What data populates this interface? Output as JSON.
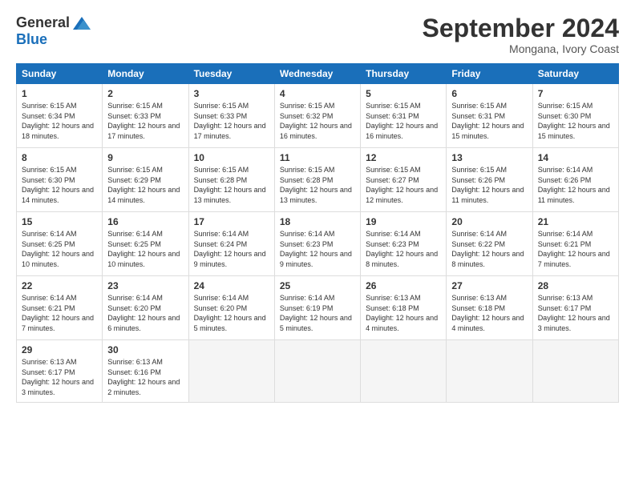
{
  "logo": {
    "general": "General",
    "blue": "Blue"
  },
  "title": "September 2024",
  "location": "Mongana, Ivory Coast",
  "headers": [
    "Sunday",
    "Monday",
    "Tuesday",
    "Wednesday",
    "Thursday",
    "Friday",
    "Saturday"
  ],
  "weeks": [
    [
      {
        "day": "1",
        "sunrise": "6:15 AM",
        "sunset": "6:34 PM",
        "daylight": "12 hours and 18 minutes."
      },
      {
        "day": "2",
        "sunrise": "6:15 AM",
        "sunset": "6:33 PM",
        "daylight": "12 hours and 17 minutes."
      },
      {
        "day": "3",
        "sunrise": "6:15 AM",
        "sunset": "6:33 PM",
        "daylight": "12 hours and 17 minutes."
      },
      {
        "day": "4",
        "sunrise": "6:15 AM",
        "sunset": "6:32 PM",
        "daylight": "12 hours and 16 minutes."
      },
      {
        "day": "5",
        "sunrise": "6:15 AM",
        "sunset": "6:31 PM",
        "daylight": "12 hours and 16 minutes."
      },
      {
        "day": "6",
        "sunrise": "6:15 AM",
        "sunset": "6:31 PM",
        "daylight": "12 hours and 15 minutes."
      },
      {
        "day": "7",
        "sunrise": "6:15 AM",
        "sunset": "6:30 PM",
        "daylight": "12 hours and 15 minutes."
      }
    ],
    [
      {
        "day": "8",
        "sunrise": "6:15 AM",
        "sunset": "6:30 PM",
        "daylight": "12 hours and 14 minutes."
      },
      {
        "day": "9",
        "sunrise": "6:15 AM",
        "sunset": "6:29 PM",
        "daylight": "12 hours and 14 minutes."
      },
      {
        "day": "10",
        "sunrise": "6:15 AM",
        "sunset": "6:28 PM",
        "daylight": "12 hours and 13 minutes."
      },
      {
        "day": "11",
        "sunrise": "6:15 AM",
        "sunset": "6:28 PM",
        "daylight": "12 hours and 13 minutes."
      },
      {
        "day": "12",
        "sunrise": "6:15 AM",
        "sunset": "6:27 PM",
        "daylight": "12 hours and 12 minutes."
      },
      {
        "day": "13",
        "sunrise": "6:15 AM",
        "sunset": "6:26 PM",
        "daylight": "12 hours and 11 minutes."
      },
      {
        "day": "14",
        "sunrise": "6:14 AM",
        "sunset": "6:26 PM",
        "daylight": "12 hours and 11 minutes."
      }
    ],
    [
      {
        "day": "15",
        "sunrise": "6:14 AM",
        "sunset": "6:25 PM",
        "daylight": "12 hours and 10 minutes."
      },
      {
        "day": "16",
        "sunrise": "6:14 AM",
        "sunset": "6:25 PM",
        "daylight": "12 hours and 10 minutes."
      },
      {
        "day": "17",
        "sunrise": "6:14 AM",
        "sunset": "6:24 PM",
        "daylight": "12 hours and 9 minutes."
      },
      {
        "day": "18",
        "sunrise": "6:14 AM",
        "sunset": "6:23 PM",
        "daylight": "12 hours and 9 minutes."
      },
      {
        "day": "19",
        "sunrise": "6:14 AM",
        "sunset": "6:23 PM",
        "daylight": "12 hours and 8 minutes."
      },
      {
        "day": "20",
        "sunrise": "6:14 AM",
        "sunset": "6:22 PM",
        "daylight": "12 hours and 8 minutes."
      },
      {
        "day": "21",
        "sunrise": "6:14 AM",
        "sunset": "6:21 PM",
        "daylight": "12 hours and 7 minutes."
      }
    ],
    [
      {
        "day": "22",
        "sunrise": "6:14 AM",
        "sunset": "6:21 PM",
        "daylight": "12 hours and 7 minutes."
      },
      {
        "day": "23",
        "sunrise": "6:14 AM",
        "sunset": "6:20 PM",
        "daylight": "12 hours and 6 minutes."
      },
      {
        "day": "24",
        "sunrise": "6:14 AM",
        "sunset": "6:20 PM",
        "daylight": "12 hours and 5 minutes."
      },
      {
        "day": "25",
        "sunrise": "6:14 AM",
        "sunset": "6:19 PM",
        "daylight": "12 hours and 5 minutes."
      },
      {
        "day": "26",
        "sunrise": "6:13 AM",
        "sunset": "6:18 PM",
        "daylight": "12 hours and 4 minutes."
      },
      {
        "day": "27",
        "sunrise": "6:13 AM",
        "sunset": "6:18 PM",
        "daylight": "12 hours and 4 minutes."
      },
      {
        "day": "28",
        "sunrise": "6:13 AM",
        "sunset": "6:17 PM",
        "daylight": "12 hours and 3 minutes."
      }
    ],
    [
      {
        "day": "29",
        "sunrise": "6:13 AM",
        "sunset": "6:17 PM",
        "daylight": "12 hours and 3 minutes."
      },
      {
        "day": "30",
        "sunrise": "6:13 AM",
        "sunset": "6:16 PM",
        "daylight": "12 hours and 2 minutes."
      },
      null,
      null,
      null,
      null,
      null
    ]
  ]
}
